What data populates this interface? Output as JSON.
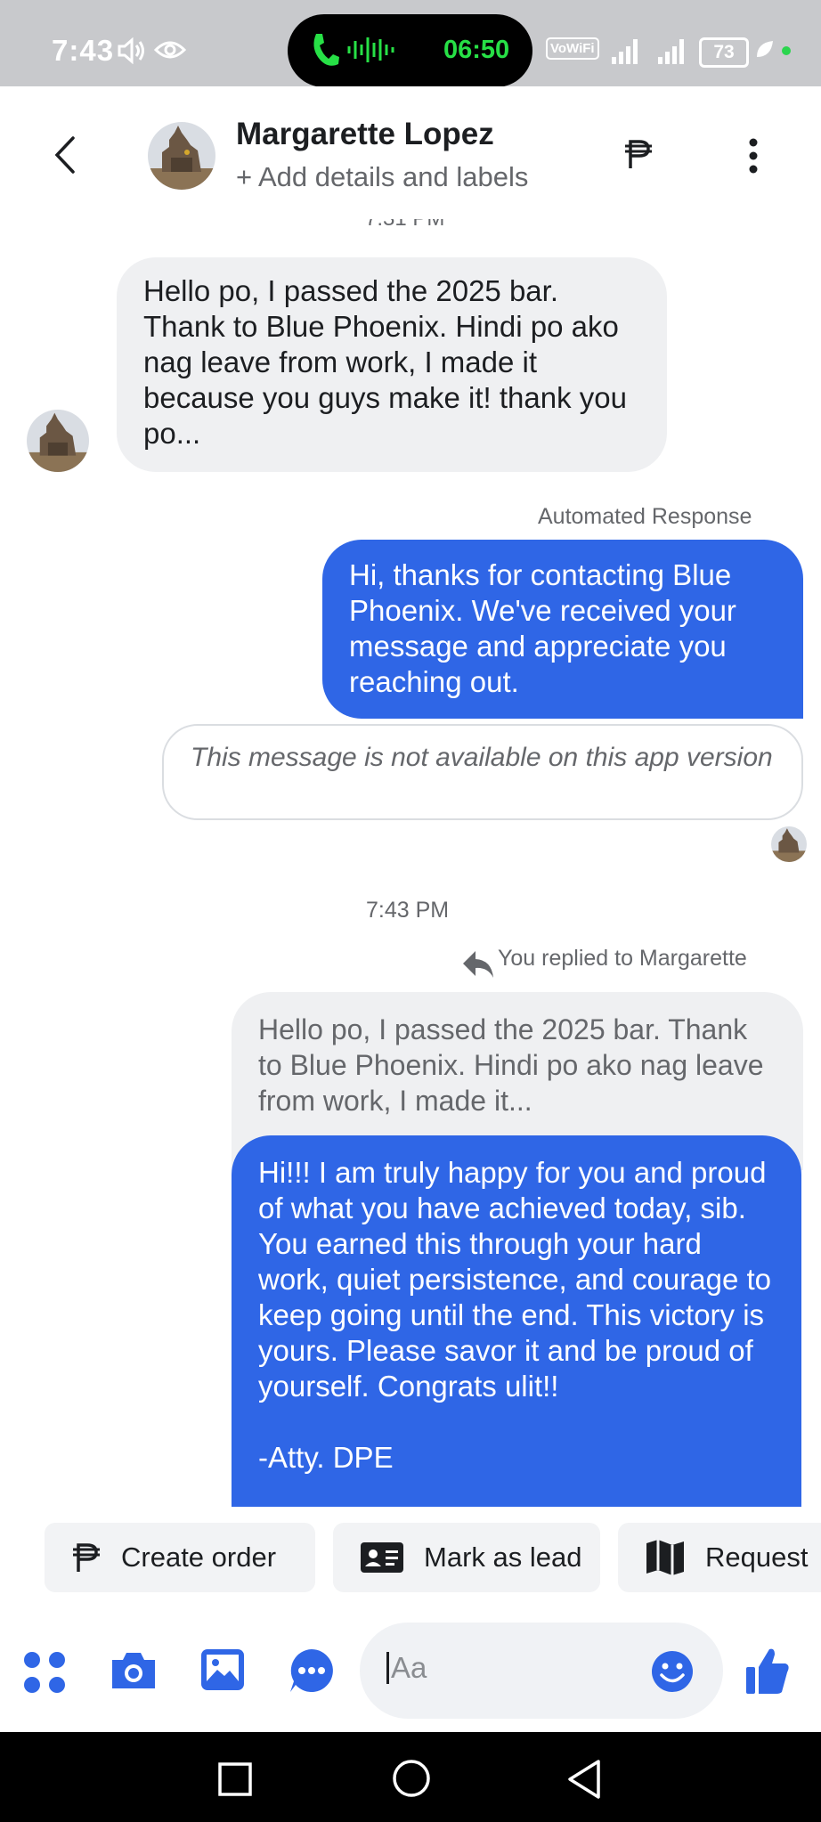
{
  "status_bar": {
    "time": "7:43",
    "call_timer": "06:50",
    "wifi_label": "VoWiFi",
    "battery": "73",
    "icons": [
      "volume-icon",
      "eye-icon",
      "phone-icon",
      "voice-wave-icon",
      "wifi-calling-icon",
      "signal-icon",
      "battery-icon",
      "leaf-icon"
    ]
  },
  "header": {
    "contact_name": "Margarette Lopez",
    "subtitle": "+ Add details and labels"
  },
  "messages": {
    "time_partial": "7:31 PM",
    "incoming_1": "Hello po, I passed the 2025 bar. Thank to Blue Phoenix. Hindi po ako nag leave from work, I made it because you guys make it! thank you po...",
    "automated_label": "Automated Response",
    "auto_reply": "Hi, thanks for contacting Blue Phoenix. We've received your message and appreciate you reaching out.",
    "unavailable_notice": "This message is not available on this app version",
    "time_divider": "7:43 PM",
    "replied_label": "You replied to Margarette",
    "quoted_text": "Hello po, I passed the 2025 bar. Thank to Blue Phoenix. Hindi po ako nag leave from work, I made it...",
    "reply_text": "Hi!!! I am truly happy for you and proud of what you have achieved today, sib. You earned this through your hard work, quiet persistence, and courage to keep going until the end. This victory is yours. Please savor it and be proud of yourself. Congrats ulit!!\n\n-Atty. DPE"
  },
  "quick_actions": {
    "create_order": "Create order",
    "mark_as_lead": "Mark as lead",
    "request": "Request"
  },
  "composer": {
    "placeholder": "Aa"
  },
  "colors": {
    "accent": "#2f66e6",
    "incoming_bubble": "#eff0f2",
    "status_bar": "#c8c9cc"
  }
}
